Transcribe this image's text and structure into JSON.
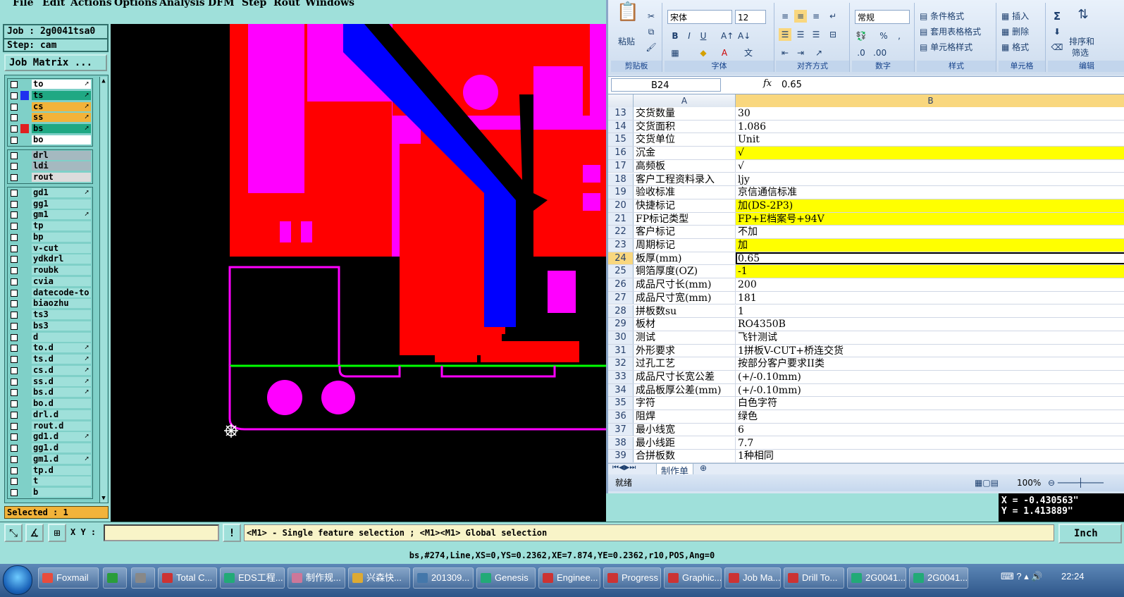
{
  "menu": [
    "File",
    "Edit",
    "Actions",
    "Options",
    "Analysis",
    "DFM",
    "Step",
    "Rout",
    "Windows"
  ],
  "job": {
    "job_label": "Job : 2g0041tsa0",
    "step_label": "Step: cam",
    "matrix_button": "Job Matrix ..."
  },
  "layers": {
    "group1": [
      {
        "name": "to",
        "color": "#ffffff",
        "mark": "",
        "arrow": "➚"
      },
      {
        "name": "ts",
        "color": "#1fa883",
        "mark": "#1f2ff0",
        "arrow": "➚"
      },
      {
        "name": "cs",
        "color": "#f2b33a",
        "mark": "",
        "arrow": "➚"
      },
      {
        "name": "ss",
        "color": "#f2b33a",
        "mark": "",
        "arrow": "➚"
      },
      {
        "name": "bs",
        "color": "#1fa883",
        "mark": "#e02020",
        "arrow": "➚"
      },
      {
        "name": "bo",
        "color": "#ffffff",
        "mark": "",
        "arrow": ""
      }
    ],
    "group2": [
      {
        "name": "drl",
        "color": "#a5b9c0",
        "mark": "",
        "arrow": ""
      },
      {
        "name": "ldi",
        "color": "#a5b9c0",
        "mark": "",
        "arrow": ""
      },
      {
        "name": "rout",
        "color": "#dcdcdc",
        "mark": "",
        "arrow": ""
      }
    ],
    "group3": [
      {
        "name": "gd1",
        "color": "#9fe0da",
        "mark": "",
        "arrow": "➚"
      },
      {
        "name": "gg1",
        "color": "#9fe0da",
        "mark": "",
        "arrow": ""
      },
      {
        "name": "gm1",
        "color": "#9fe0da",
        "mark": "",
        "arrow": "➚"
      },
      {
        "name": "tp",
        "color": "#9fe0da",
        "mark": "",
        "arrow": ""
      },
      {
        "name": "bp",
        "color": "#9fe0da",
        "mark": "",
        "arrow": ""
      },
      {
        "name": "v-cut",
        "color": "#9fe0da",
        "mark": "",
        "arrow": ""
      },
      {
        "name": "ydkdrl",
        "color": "#9fe0da",
        "mark": "",
        "arrow": ""
      },
      {
        "name": "roubk",
        "color": "#9fe0da",
        "mark": "",
        "arrow": ""
      },
      {
        "name": "cvia",
        "color": "#9fe0da",
        "mark": "",
        "arrow": ""
      },
      {
        "name": "datecode-to",
        "color": "#9fe0da",
        "mark": "",
        "arrow": ""
      },
      {
        "name": "biaozhu",
        "color": "#9fe0da",
        "mark": "",
        "arrow": ""
      },
      {
        "name": "ts3",
        "color": "#9fe0da",
        "mark": "",
        "arrow": ""
      },
      {
        "name": "bs3",
        "color": "#9fe0da",
        "mark": "",
        "arrow": ""
      },
      {
        "name": "d",
        "color": "#9fe0da",
        "mark": "",
        "arrow": ""
      },
      {
        "name": "to.d",
        "color": "#9fe0da",
        "mark": "",
        "arrow": "➚"
      },
      {
        "name": "ts.d",
        "color": "#9fe0da",
        "mark": "",
        "arrow": "➚"
      },
      {
        "name": "cs.d",
        "color": "#9fe0da",
        "mark": "",
        "arrow": "➚"
      },
      {
        "name": "ss.d",
        "color": "#9fe0da",
        "mark": "",
        "arrow": "➚"
      },
      {
        "name": "bs.d",
        "color": "#9fe0da",
        "mark": "",
        "arrow": "➚"
      },
      {
        "name": "bo.d",
        "color": "#9fe0da",
        "mark": "",
        "arrow": ""
      },
      {
        "name": "drl.d",
        "color": "#9fe0da",
        "mark": "",
        "arrow": ""
      },
      {
        "name": "rout.d",
        "color": "#9fe0da",
        "mark": "",
        "arrow": ""
      },
      {
        "name": "gd1.d",
        "color": "#9fe0da",
        "mark": "",
        "arrow": "➚"
      },
      {
        "name": "gg1.d",
        "color": "#9fe0da",
        "mark": "",
        "arrow": ""
      },
      {
        "name": "gm1.d",
        "color": "#9fe0da",
        "mark": "",
        "arrow": "➚"
      },
      {
        "name": "tp.d",
        "color": "#9fe0da",
        "mark": "",
        "arrow": ""
      },
      {
        "name": "t",
        "color": "#9fe0da",
        "mark": "",
        "arrow": ""
      },
      {
        "name": "b",
        "color": "#9fe0da",
        "mark": "",
        "arrow": ""
      }
    ]
  },
  "selected_text": "Selected : 1",
  "coords": {
    "x": "X = -0.430563\"",
    "y": "Y =  1.413889\""
  },
  "xy_label": "X Y :",
  "help_text": "<M1> - Single feature selection ; <M1><M1> Global selection",
  "unit": "Inch",
  "status_line": "bs,#274,Line,XS=0,YS=0.2362,XE=7.874,YE=0.2362,r10,POS,Ang=0",
  "excel": {
    "font_name": "宋体",
    "font_size": "12",
    "number_format": "常规",
    "paste_label": "粘贴",
    "group_labels": [
      "剪贴板",
      "字体",
      "对齐方式",
      "数字",
      "样式",
      "单元格",
      "编辑"
    ],
    "style_items": [
      "条件格式",
      "套用表格格式",
      "单元格样式"
    ],
    "cell_items": [
      "插入",
      "删除",
      "格式"
    ],
    "edit_items": [
      "排序和",
      "筛选"
    ],
    "name_box": "B24",
    "fx": "fx",
    "formula_value": "0.65",
    "col_a": "A",
    "col_b": "B",
    "rows": [
      {
        "n": "13",
        "a": "交货数量",
        "b": "30",
        "hl": false
      },
      {
        "n": "14",
        "a": "交货面积",
        "b": "1.086",
        "hl": false
      },
      {
        "n": "15",
        "a": "交货单位",
        "b": "Unit",
        "hl": false
      },
      {
        "n": "16",
        "a": "沉金",
        "b": "√",
        "hl": true
      },
      {
        "n": "17",
        "a": "高频板",
        "b": "√",
        "hl": false
      },
      {
        "n": "18",
        "a": "客户工程资料录入",
        "b": "ljy",
        "hl": false
      },
      {
        "n": "19",
        "a": "验收标准",
        "b": "京信通信标准",
        "hl": false
      },
      {
        "n": "20",
        "a": "快捷标记",
        "b": "加(DS-2P3)",
        "hl": true
      },
      {
        "n": "21",
        "a": "FP标记类型",
        "b": "FP+E档案号+94V",
        "hl": true
      },
      {
        "n": "22",
        "a": "客户标记",
        "b": "不加",
        "hl": false
      },
      {
        "n": "23",
        "a": "周期标记",
        "b": "加",
        "hl": true
      },
      {
        "n": "24",
        "a": "板厚(mm)",
        "b": "0.65",
        "hl": false
      },
      {
        "n": "25",
        "a": "铜箔厚度(OZ)",
        "b": "-1",
        "hl": true
      },
      {
        "n": "26",
        "a": "成品尺寸长(mm)",
        "b": "200",
        "hl": false
      },
      {
        "n": "27",
        "a": "成品尺寸宽(mm)",
        "b": "181",
        "hl": false
      },
      {
        "n": "28",
        "a": "拼板数su",
        "b": "1",
        "hl": false
      },
      {
        "n": "29",
        "a": "板材",
        "b": "RO4350B",
        "hl": false
      },
      {
        "n": "30",
        "a": "测试",
        "b": "飞针测试",
        "hl": false
      },
      {
        "n": "31",
        "a": "外形要求",
        "b": "1拼板V-CUT+桥连交货",
        "hl": false
      },
      {
        "n": "32",
        "a": "过孔工艺",
        "b": "按部分客户要求II类",
        "hl": false
      },
      {
        "n": "33",
        "a": "成品尺寸长宽公差",
        "b": "(+/-0.10mm)",
        "hl": false
      },
      {
        "n": "34",
        "a": "成品板厚公差(mm)",
        "b": "(+/-0.10mm)",
        "hl": false
      },
      {
        "n": "35",
        "a": "字符",
        "b": "白色字符",
        "hl": false
      },
      {
        "n": "36",
        "a": "阻焊",
        "b": "绿色",
        "hl": false
      },
      {
        "n": "37",
        "a": "最小线宽",
        "b": "6",
        "hl": false
      },
      {
        "n": "38",
        "a": "最小线距",
        "b": "7.7",
        "hl": false
      },
      {
        "n": "39",
        "a": "合拼板数",
        "b": "1种相同",
        "hl": false
      }
    ],
    "sheet_tab": "制作单",
    "status": "就绪",
    "zoom": "100%"
  },
  "taskbar": {
    "tasks": [
      "Foxmail",
      "",
      "",
      "Total C...",
      "EDS工程...",
      "制作规...",
      "兴森快...",
      "201309...",
      "Genesis",
      "Enginee...",
      "Progress",
      "Graphic...",
      "Job Ma...",
      "Drill To...",
      "2G0041...",
      "2G0041..."
    ],
    "clock": "22:24"
  },
  "colors": {
    "board_pink": "#ff00ff",
    "copper_red": "#ff0000",
    "trace_blue": "#0000ff",
    "outline_green": "#00ff00",
    "highlight_yellow": "#ffff00"
  }
}
